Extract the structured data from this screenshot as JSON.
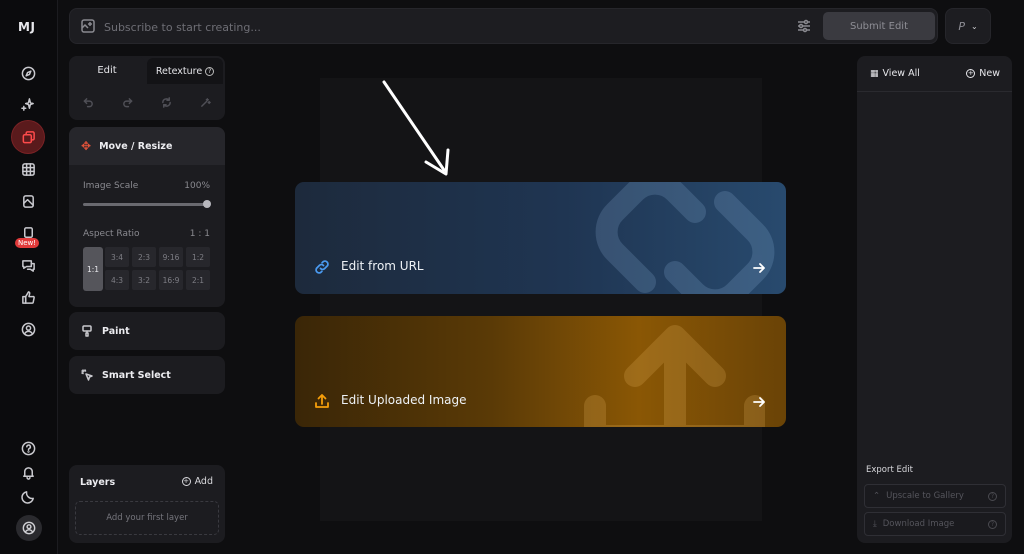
{
  "app": {
    "logo": "MJ"
  },
  "rail": {
    "new_badge": "New!",
    "items": [
      "explore-icon",
      "create-icon",
      "edit-icon",
      "organize-icon",
      "personalize-icon",
      "moodboard-icon",
      "chat-icon",
      "tasks-icon",
      "account-icon"
    ],
    "bottom": [
      "help-icon",
      "notifications-icon",
      "theme-icon",
      "profile-icon"
    ]
  },
  "prompt": {
    "placeholder": "Subscribe to start creating...",
    "submit_label": "Submit Edit",
    "profile_label": "P",
    "chevron": "⌄"
  },
  "tools": {
    "tab_edit": "Edit",
    "tab_retexture": "Retexture",
    "retexture_help": "?",
    "move_resize": "Move / Resize",
    "image_scale_label": "Image Scale",
    "image_scale_value": "100%",
    "aspect_ratio_label": "Aspect Ratio",
    "aspect_ratio_value": "1 : 1",
    "ratio_selected": "1:1",
    "ratios": [
      "3:4",
      "2:3",
      "9:16",
      "1:2",
      "4:3",
      "3:2",
      "16:9",
      "2:1"
    ],
    "paint": "Paint",
    "smart_select": "Smart Select"
  },
  "layers": {
    "title": "Layers",
    "add_label": "Add",
    "add_icon": "+",
    "empty": "Add your first layer"
  },
  "canvas": {
    "edit_from_url": "Edit from URL",
    "edit_uploaded": "Edit Uploaded Image",
    "accent_blue": "#2a76c9",
    "accent_orange": "#f59e0b"
  },
  "right_panel": {
    "view_all": "View All",
    "new_label": "New",
    "new_icon": "+",
    "export_title": "Export Edit",
    "upscale": "Upscale to Gallery",
    "download": "Download Image",
    "help_icon": "?"
  }
}
